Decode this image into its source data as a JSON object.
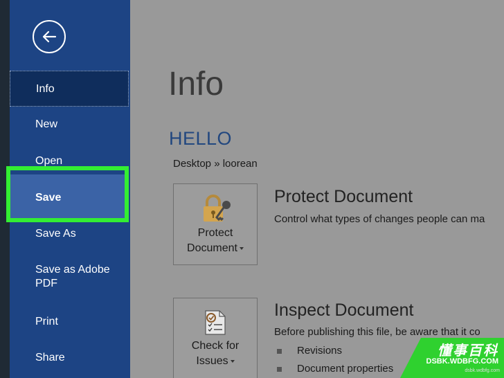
{
  "sidebar": {
    "items": [
      {
        "label": "Info"
      },
      {
        "label": "New"
      },
      {
        "label": "Open"
      },
      {
        "label": "Save"
      },
      {
        "label": "Save As"
      },
      {
        "label": "Save as Adobe PDF"
      },
      {
        "label": "Print"
      },
      {
        "label": "Share"
      }
    ]
  },
  "main": {
    "title": "Info",
    "doc_name": "HELLO",
    "doc_path": "Desktop » loorean",
    "protect": {
      "tile_line1": "Protect",
      "tile_line2": "Document",
      "title": "Protect Document",
      "description": "Control what types of changes people can ma"
    },
    "inspect": {
      "tile_line1": "Check for",
      "tile_line2": "Issues",
      "title": "Inspect Document",
      "description": "Before publishing this file, be aware that it co",
      "bullets": [
        "Revisions",
        "Document properties"
      ]
    }
  },
  "watermark": {
    "brand": "懂事百科",
    "url": "DSBK.WDBFG.COM",
    "small": "dsbk.wdbfg.com"
  },
  "colors": {
    "sidebar": "#1d4484",
    "active_item": "#0f2d5c",
    "hover_item": "#3b63a6",
    "highlight": "#33ee33",
    "doc_name": "#22477f",
    "watermark_green": "#2fd12f"
  }
}
